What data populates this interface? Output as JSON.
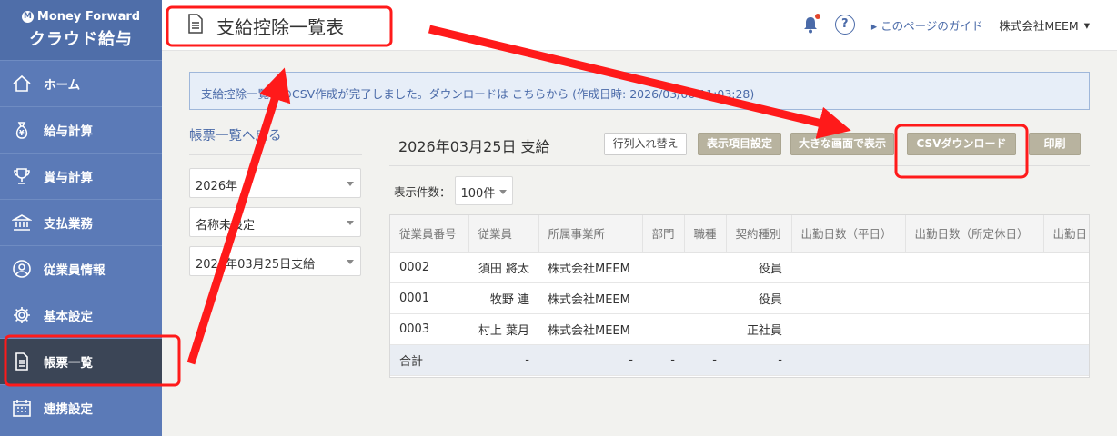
{
  "brand": {
    "company": "Money Forward",
    "product": "クラウド給与"
  },
  "sidebar": {
    "items": [
      {
        "label": "ホーム",
        "icon": "home-icon"
      },
      {
        "label": "給与計算",
        "icon": "money-bag-icon"
      },
      {
        "label": "賞与計算",
        "icon": "trophy-icon"
      },
      {
        "label": "支払業務",
        "icon": "bank-icon"
      },
      {
        "label": "従業員情報",
        "icon": "user-icon"
      },
      {
        "label": "基本設定",
        "icon": "gear-icon"
      },
      {
        "label": "帳票一覧",
        "icon": "document-icon"
      },
      {
        "label": "連携設定",
        "icon": "calendar-grid-icon"
      }
    ],
    "active_index": 6
  },
  "header": {
    "title": "支給控除一覧表",
    "guide": "このページのガイド",
    "company": "株式会社MEEM"
  },
  "notice": {
    "text": "支給控除一覧表のCSV作成が完了しました。ダウンロードは こちらから (作成日時: 2026/03/06 11:03:28)"
  },
  "left": {
    "back_link": "帳票一覧へ戻る",
    "year": "2026年",
    "scope": "名称未設定",
    "payday": "2026年03月25日支給"
  },
  "main": {
    "pay_title": "2026年03月25日 支給",
    "buttons": {
      "swap": "行列入れ替え",
      "columns": "表示項目設定",
      "large": "大きな画面で表示",
      "csv": "CSVダウンロード",
      "print": "印刷"
    },
    "per_page_label": "表示件数：",
    "per_page_value": "100件"
  },
  "table": {
    "headers": [
      "従業員番号",
      "従業員",
      "所属事業所",
      "部門",
      "職種",
      "契約種別",
      "出勤日数（平日）",
      "出勤日数（所定休日）",
      "出勤日"
    ],
    "rows": [
      [
        "0002",
        "須田 將太",
        "株式会社MEEM",
        "",
        "",
        "役員",
        "",
        "",
        ""
      ],
      [
        "0001",
        "牧野 連",
        "株式会社MEEM",
        "",
        "",
        "役員",
        "",
        "",
        ""
      ],
      [
        "0003",
        "村上 葉月",
        "株式会社MEEM",
        "",
        "",
        "正社員",
        "",
        "",
        ""
      ]
    ],
    "total": [
      "合計",
      "-",
      "-",
      "-",
      "-",
      "-",
      "",
      "",
      ""
    ]
  },
  "colors": {
    "sidebar": "#5b7ab7",
    "sidebar_active": "#3b4556",
    "accent": "#4a6aa8",
    "annotation": "#ff1a1a",
    "notification": "#e2452c"
  }
}
